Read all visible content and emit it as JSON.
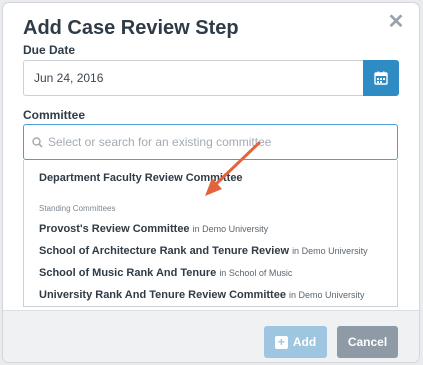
{
  "modal": {
    "title": "Add Case Review Step",
    "close_icon": "close-icon"
  },
  "due_date": {
    "label": "Due Date",
    "value": "Jun 24, 2016",
    "calendar_icon": "calendar-icon"
  },
  "committee": {
    "label": "Committee",
    "placeholder": "Select or search for an existing committee",
    "search_icon": "search-icon"
  },
  "dropdown": {
    "top_item": "Department Faculty Review Committee",
    "group_label": "Standing Committees",
    "items": [
      {
        "name": "Provost's Review Committee",
        "context": "in Demo University"
      },
      {
        "name": "School of Architecture Rank and Tenure Review",
        "context": "in Demo University"
      },
      {
        "name": "School of Music Rank And Tenure",
        "context": "in School of Music"
      },
      {
        "name": "University Rank And Tenure Review Committee",
        "context": "in Demo University"
      }
    ]
  },
  "footer": {
    "add_label": "Add",
    "cancel_label": "Cancel"
  },
  "colors": {
    "primary": "#2e8bc4",
    "add_disabled": "#9ec6e0",
    "cancel": "#8e9aa5",
    "annotation_arrow": "#e3643c"
  }
}
